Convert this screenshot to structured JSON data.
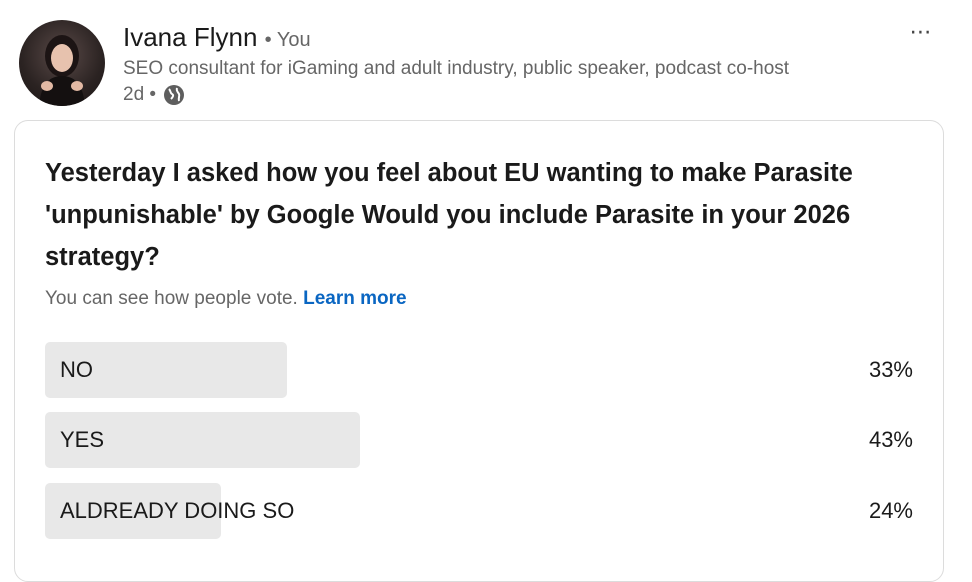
{
  "author": {
    "name": "Ivana Flynn",
    "relation": "• You",
    "headline": "SEO consultant for iGaming and adult industry, public speaker, podcast co-host",
    "time": "2d •",
    "visibility_icon": "globe-icon"
  },
  "more_icon": "⋯",
  "poll": {
    "question": "Yesterday I asked how you feel about EU wanting to make Parasite 'unpunishable' by Google Would you include Parasite in your 2026 strategy?",
    "note": "You can see how people vote.",
    "learn_more": "Learn more",
    "options": [
      {
        "label": "NO",
        "percent_text": "33%",
        "percent": 33
      },
      {
        "label": "YES",
        "percent_text": "43%",
        "percent": 43
      },
      {
        "label": "ALDREADY DOING SO",
        "percent_text": "24%",
        "percent": 24
      }
    ]
  },
  "colors": {
    "link": "#0a66c2",
    "bar": "#e8e8e8",
    "muted_text": "#666666"
  }
}
